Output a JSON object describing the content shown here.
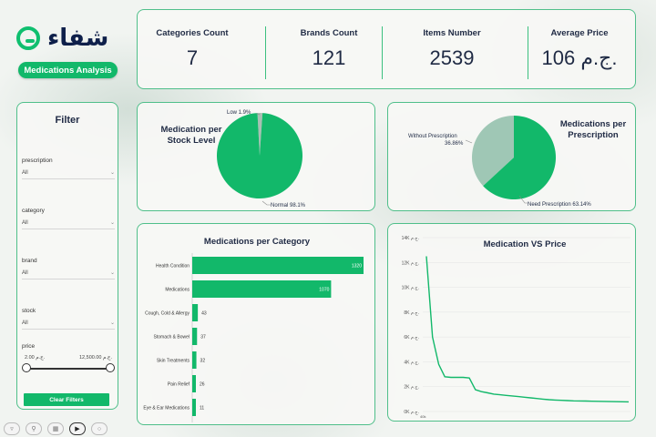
{
  "brand": {
    "logo_text": "شفاء",
    "title": "Medications Analysis"
  },
  "kpis": [
    {
      "label": "Categories Count",
      "value": "7"
    },
    {
      "label": "Brands Count",
      "value": "121"
    },
    {
      "label": "Items Number",
      "value": "2539"
    },
    {
      "label": "Average Price",
      "value": "106 ج.م."
    }
  ],
  "filter": {
    "title": "Filter",
    "fields": [
      {
        "label": "prescription",
        "value": "All"
      },
      {
        "label": "category",
        "value": "All"
      },
      {
        "label": "brand",
        "value": "All"
      },
      {
        "label": "stock",
        "value": "All"
      }
    ],
    "price": {
      "label": "price",
      "min": "2.00 ج.م.",
      "max": "12,500.00 ج.م."
    },
    "clear_label": "Clear Filters"
  },
  "stock_chart": {
    "title_line1": "Medication per",
    "title_line2": "Stock Level",
    "low_label": "Low 1.9%",
    "normal_label": "Normal 98.1%"
  },
  "prescription_chart": {
    "title_line1": "Medications per",
    "title_line2": "Prescription",
    "without_label_1": "Without Prescription",
    "without_label_2": "36.86%",
    "need_label": "Need Prescription 63.14%"
  },
  "category_chart": {
    "title": "Medications per Category"
  },
  "price_chart": {
    "title": "Medication VS Price",
    "x_tick": "40k"
  },
  "colors": {
    "accent": "#12b86a",
    "muted": "#9fc7b5",
    "border": "#4fbf8a",
    "text": "#1f2a44"
  },
  "chart_data": [
    {
      "type": "pie",
      "categories": [
        "Low",
        "Normal"
      ],
      "values": [
        1.9,
        98.1
      ]
    },
    {
      "type": "pie",
      "categories": [
        "Without Prescription",
        "Need Prescription"
      ],
      "values": [
        36.86,
        63.14
      ]
    },
    {
      "type": "bar",
      "title": "Medications per Category",
      "categories": [
        "Health Condition",
        "Medications",
        "Cough, Cold & Allergy",
        "Stomach & Bowel",
        "Skin Treatments",
        "Pain Relief",
        "Eye & Ear Medications"
      ],
      "values": [
        1320,
        1070,
        43,
        37,
        32,
        26,
        11
      ]
    },
    {
      "type": "line",
      "title": "Medication VS Price",
      "y_ticks": [
        "0K ج.م.",
        "2K ج.م.",
        "4K ج.م.",
        "6K ج.م.",
        "8K ج.م.",
        "10K ج.م.",
        "12K ج.م.",
        "14K ج.م."
      ],
      "ylim": [
        0,
        14000
      ],
      "values": [
        12500,
        6000,
        3800,
        2800,
        2750,
        2750,
        2750,
        2700,
        1750,
        1600,
        1500,
        1400,
        1350,
        1300,
        1250,
        1200,
        1150,
        1100,
        1050,
        1000,
        950,
        920,
        900,
        880,
        860,
        850,
        840,
        830,
        820,
        810,
        800,
        790,
        785,
        780
      ]
    }
  ]
}
